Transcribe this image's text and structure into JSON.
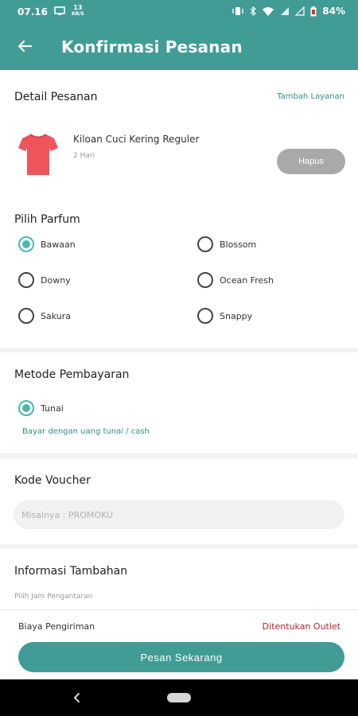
{
  "status_bar": {
    "time": "07.16",
    "data_speed": "13",
    "data_unit": "KB/S",
    "battery": "84%"
  },
  "header": {
    "title": "Konfirmasi Pesanan",
    "back_icon": "arrow-left-icon"
  },
  "order_detail": {
    "heading": "Detail Pesanan",
    "add_service_link": "Tambah Layanan",
    "item": {
      "name": "Kiloan Cuci Kering Reguler",
      "duration": "2 Hari",
      "delete_label": "Hapus",
      "icon": "t-shirt-icon"
    }
  },
  "perfume": {
    "heading": "Pilih Parfum",
    "options": [
      "Bawaan",
      "Blossom",
      "Downy",
      "Ocean Fresh",
      "Sakura",
      "Snappy"
    ],
    "selected": "Bawaan"
  },
  "payment": {
    "heading": "Metode Pembayaran",
    "option": "Tunai",
    "selected": "Tunai",
    "description": "Bayar dengan uang tunai / cash"
  },
  "voucher": {
    "heading": "Kode Voucher",
    "placeholder": "Misalnya : PROMOKU",
    "value": ""
  },
  "additional_info": {
    "heading": "Informasi Tambahan",
    "sub_label": "Pilih Jam Pengantaran"
  },
  "footer": {
    "shipping_label": "Biaya Pengiriman",
    "shipping_value": "Ditentukan Outlet",
    "order_button": "Pesan Sekarang"
  },
  "colors": {
    "primary": "#419c95",
    "accent": "#4bb8ae",
    "shipping_value": "#b8232f",
    "delete_button": "#a9a9a9",
    "shirt": "#f0545b"
  }
}
